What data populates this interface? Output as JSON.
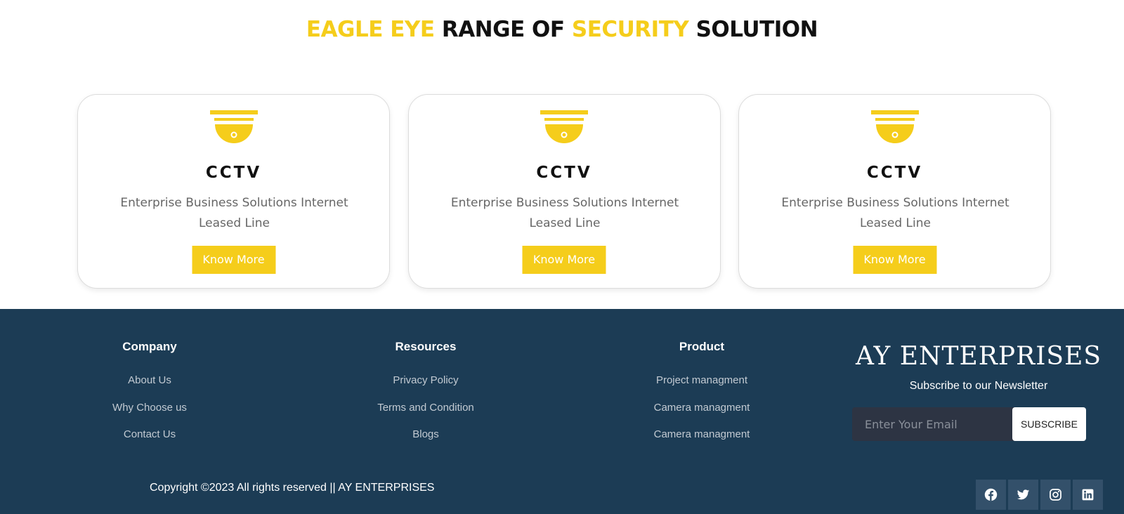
{
  "heading": {
    "part1": "EAGLE EYE",
    "part2": " RANGE OF ",
    "part3": "SECURITY",
    "part4": " SOLUTION"
  },
  "cards": [
    {
      "title": "CCTV",
      "description": "Enterprise Business Solutions Internet Leased Line",
      "button": "Know More",
      "icon": "security-camera-icon"
    },
    {
      "title": "CCTV",
      "description": "Enterprise Business Solutions Internet Leased Line",
      "button": "Know More",
      "icon": "security-camera-icon"
    },
    {
      "title": "CCTV",
      "description": "Enterprise Business Solutions Internet Leased Line",
      "button": "Know More",
      "icon": "security-camera-icon"
    }
  ],
  "footer": {
    "company": {
      "title": "Company",
      "links": [
        "About Us",
        "Why Choose us",
        "Contact Us"
      ]
    },
    "resources": {
      "title": "Resources",
      "links": [
        "Privacy Policy",
        "Terms and Condition",
        "Blogs"
      ]
    },
    "product": {
      "title": "Product",
      "links": [
        "Project managment",
        "Camera managment",
        "Camera managment"
      ]
    },
    "brand": "AY ENTERPRISES",
    "newsletter_label": "Subscribe to our Newsletter",
    "email_placeholder": "Enter Your Email",
    "subscribe_label": "SUBSCRIBE",
    "copyright": "Copyright ©2023 All rights reserved || AY ENTERPRISES",
    "social": [
      "facebook-icon",
      "twitter-icon",
      "instagram-icon",
      "linkedin-icon"
    ]
  },
  "colors": {
    "accent": "#f5cd1b",
    "footer_bg": "#1c3c55",
    "social_bg": "#33506a"
  }
}
